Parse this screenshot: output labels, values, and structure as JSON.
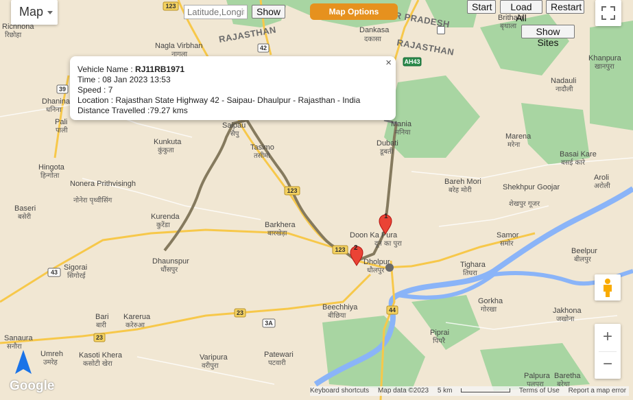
{
  "map_type": {
    "label": "Map"
  },
  "search": {
    "placeholder": "Latitude,Longitude",
    "show_label": "Show"
  },
  "map_options": {
    "label": "Map Options"
  },
  "controls": {
    "start": "Start",
    "load_all": "Load All",
    "restart": "Restart",
    "show_sites": "Show Sites"
  },
  "info_window": {
    "vehicle_label": "Vehicle Name : ",
    "vehicle": "RJ11RB1971",
    "time": "Time : 08 Jan 2023 13:53",
    "speed": "Speed : 7",
    "location": "Location : Rajasthan State Highway 42 - Saipau- Dhaulpur - Rajasthan - India",
    "distance": "Distance Travelled :79.27 kms",
    "close": "×"
  },
  "markers": [
    {
      "label": "1"
    },
    {
      "label": "2"
    }
  ],
  "places": [
    {
      "en": "Richnona",
      "hi": "रिछोहा"
    },
    {
      "en": "Nagla Virbhan",
      "hi": "नागला"
    },
    {
      "en": "Dankasa",
      "hi": "दकासा"
    },
    {
      "en": "Brithala",
      "hi": "बृथाला"
    },
    {
      "en": "Khanpura",
      "hi": "खानपुरा"
    },
    {
      "en": "Nadauli",
      "hi": "नादौली"
    },
    {
      "en": "Dhanina",
      "hi": "धनिना"
    },
    {
      "en": "Pali",
      "hi": "पाली"
    },
    {
      "en": "Saipau",
      "hi": "सैपु"
    },
    {
      "en": "Mania",
      "hi": "मनिया"
    },
    {
      "en": "Marena",
      "hi": "मरेना"
    },
    {
      "en": "Kunkuta",
      "hi": "कुंकुता"
    },
    {
      "en": "Tasimo",
      "hi": "तसीमो"
    },
    {
      "en": "Dubati",
      "hi": "डूबती"
    },
    {
      "en": "Basai Kare",
      "hi": "बसई कारे"
    },
    {
      "en": "Hingota",
      "hi": "हिन्गोता"
    },
    {
      "en": "Bareh Mori",
      "hi": "बरेह मोरी"
    },
    {
      "en": "Aroli",
      "hi": "अरोली"
    },
    {
      "en": "Nonera Prithvisingh",
      "hi": "नोनेरा पृथ्वीसिंग"
    },
    {
      "en": "Shekhpur Goojar",
      "hi": "शेखपुर गूजर"
    },
    {
      "en": "Baseri",
      "hi": "बसेरी"
    },
    {
      "en": "Kurenda",
      "hi": "कुरेंडा"
    },
    {
      "en": "Barkhera",
      "hi": "बारखेड़ा"
    },
    {
      "en": "Doon Ka Pura",
      "hi": "दून का पुरा"
    },
    {
      "en": "Samor",
      "hi": "समोर"
    },
    {
      "en": "Dhaunspur",
      "hi": "धौंसपुर"
    },
    {
      "en": "Dholpur",
      "hi": "धौलपुर"
    },
    {
      "en": "Beelpur",
      "hi": "बीलपुर"
    },
    {
      "en": "Sigorai",
      "hi": "सिगोरई"
    },
    {
      "en": "Tighara",
      "hi": "तिघरा"
    },
    {
      "en": "Beechhiya",
      "hi": "बीछिया"
    },
    {
      "en": "Gorkha",
      "hi": "गोरखा"
    },
    {
      "en": "Jakhona",
      "hi": "जखोना"
    },
    {
      "en": "Bari",
      "hi": "बारी"
    },
    {
      "en": "Karerua",
      "hi": "करेरुआ"
    },
    {
      "en": "Piprai",
      "hi": "पिपरै"
    },
    {
      "en": "Sanaura",
      "hi": "सनौरा"
    },
    {
      "en": "Umreh",
      "hi": "उमरेह"
    },
    {
      "en": "Kasoti Khera",
      "hi": "कसोटी खेरा"
    },
    {
      "en": "Varipura",
      "hi": "वरीपुरा"
    },
    {
      "en": "Patewari",
      "hi": "पटवारी"
    },
    {
      "en": "Palpura",
      "hi": "पलपुरा"
    },
    {
      "en": "Baretha",
      "hi": "बरेथा"
    }
  ],
  "states": [
    "RAJASTHAN",
    "UTTAR PRADESH",
    "RAJASTHAN"
  ],
  "route_shields": [
    "123",
    "42",
    "39",
    "123",
    "123",
    "43",
    "23",
    "3A",
    "23",
    "44",
    "AH43"
  ],
  "footer": {
    "shortcuts": "Keyboard shortcuts",
    "mapdata": "Map data ©2023",
    "scale": "5 km",
    "terms": "Terms of Use",
    "report": "Report a map error"
  },
  "logo": "Google",
  "colors": {
    "land": "#f1e7d3",
    "forest": "#a8d5a2",
    "river": "#8ab4f8",
    "route": "#857a5e",
    "highway": "#f7c84a",
    "button_orange": "#e6911e"
  }
}
